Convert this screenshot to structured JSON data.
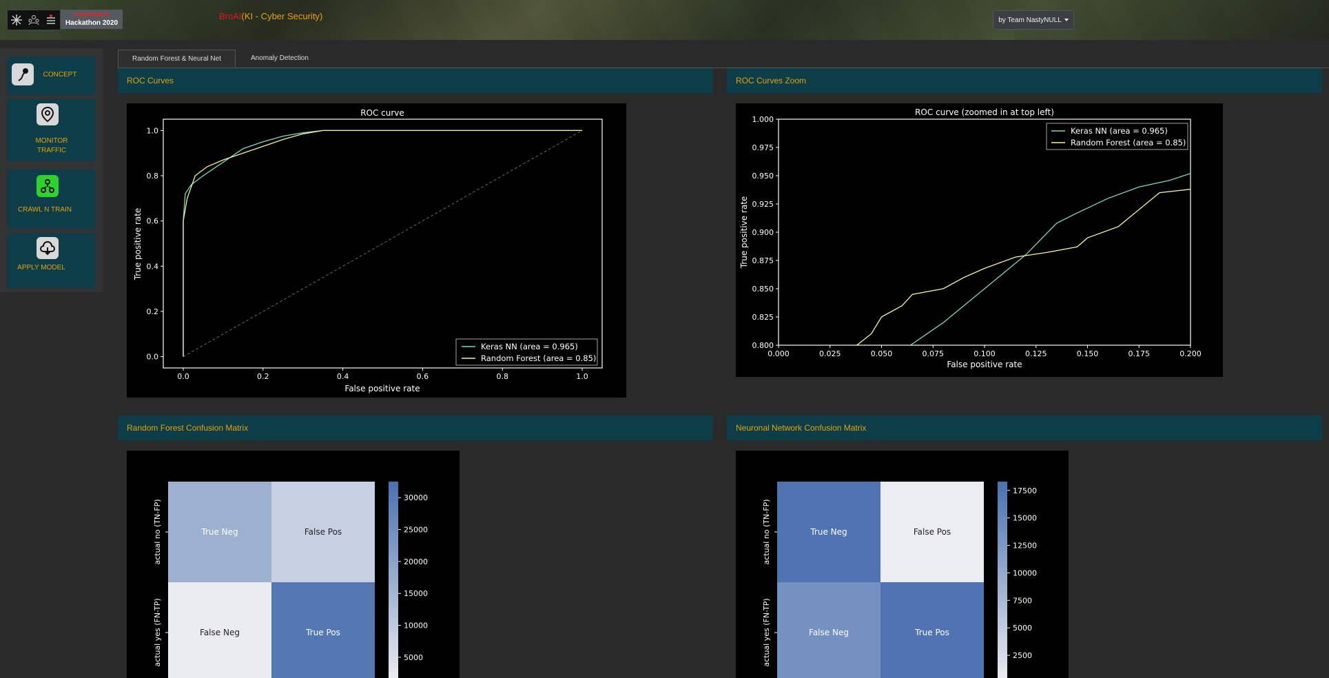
{
  "header": {
    "badge_small": "BUNDESWEHR",
    "badge_title": "Hackathon 2020",
    "brand_red": "BroAI",
    "brand_rest": "(KI - Cyber Security)",
    "team_button": "by Team NastyNULL",
    "logo_icons": [
      "cross-icon",
      "people-icon",
      "stack-icon"
    ]
  },
  "sidebar": {
    "items": [
      {
        "label": "CONCEPT",
        "icon": "sperm-icon"
      },
      {
        "label": "MONITOR TRAFFIC",
        "icon": "search-icon"
      },
      {
        "label": "CRAWL N TRAIN",
        "icon": "network-icon"
      },
      {
        "label": "APPLY MODEL",
        "icon": "cloud-icon"
      }
    ]
  },
  "tabs": [
    {
      "label": "Random Forest & Neural Net",
      "active": true
    },
    {
      "label": "Anomaly Detection",
      "active": false
    }
  ],
  "panels": {
    "roc": "ROC Curves",
    "roc_zoom": "ROC Curves Zoom",
    "rf_cm": "Random Forest Confusion Matrix",
    "nn_cm": "Neuronal Network Confusion Matrix"
  },
  "colors": {
    "accent": "#e6a300",
    "panel": "#0e3d4a",
    "nn_line": "#7fd8c4",
    "rf_line": "#f5f5a0"
  },
  "chart_data": [
    {
      "type": "line",
      "title": "ROC curve",
      "xlabel": "False positive rate",
      "ylabel": "True positive rate",
      "xlim": [
        -0.05,
        1.05
      ],
      "ylim": [
        -0.05,
        1.05
      ],
      "xticks": [
        "0.0",
        "0.2",
        "0.4",
        "0.6",
        "0.8",
        "1.0"
      ],
      "yticks": [
        "0.0",
        "0.2",
        "0.4",
        "0.6",
        "0.8",
        "1.0"
      ],
      "legend": "bottom-right",
      "series": [
        {
          "name": "Keras NN (area = 0.965)",
          "x": [
            0,
            0,
            0.005,
            0.02,
            0.05,
            0.1,
            0.15,
            0.2,
            0.25,
            0.3,
            0.35,
            0.5,
            0.8,
            1.0
          ],
          "y": [
            0,
            0.6,
            0.72,
            0.76,
            0.8,
            0.86,
            0.92,
            0.95,
            0.975,
            0.99,
            1.0,
            1.0,
            1.0,
            1.0
          ]
        },
        {
          "name": "Random Forest  (area = 0.85)",
          "x": [
            0,
            0,
            0.01,
            0.03,
            0.06,
            0.1,
            0.15,
            0.2,
            0.25,
            0.3,
            0.35,
            0.5,
            0.8,
            1.0
          ],
          "y": [
            0,
            0.6,
            0.7,
            0.8,
            0.84,
            0.87,
            0.9,
            0.93,
            0.96,
            0.985,
            1.0,
            1.0,
            1.0,
            1.0
          ]
        },
        {
          "name": "",
          "x": [
            0,
            1
          ],
          "y": [
            0,
            1
          ]
        }
      ]
    },
    {
      "type": "line",
      "title": "ROC curve (zoomed in at top left)",
      "xlabel": "False positive rate",
      "ylabel": "True positive rate",
      "xlim": [
        0,
        0.2
      ],
      "ylim": [
        0.8,
        1.0
      ],
      "xticks": [
        "0.000",
        "0.025",
        "0.050",
        "0.075",
        "0.100",
        "0.125",
        "0.150",
        "0.175",
        "0.200"
      ],
      "yticks": [
        "0.800",
        "0.825",
        "0.850",
        "0.875",
        "0.900",
        "0.925",
        "0.950",
        "0.975",
        "1.000"
      ],
      "legend": "top-right",
      "series": [
        {
          "name": "Keras NN (area = 0.965)",
          "x": [
            0.064,
            0.08,
            0.1,
            0.12,
            0.135,
            0.145,
            0.16,
            0.175,
            0.19,
            0.2
          ],
          "y": [
            0.8,
            0.82,
            0.85,
            0.88,
            0.908,
            0.917,
            0.93,
            0.94,
            0.946,
            0.952
          ]
        },
        {
          "name": "Random Forest  (area = 0.85)",
          "x": [
            0.038,
            0.045,
            0.05,
            0.06,
            0.065,
            0.08,
            0.09,
            0.1,
            0.115,
            0.13,
            0.145,
            0.15,
            0.165,
            0.175,
            0.185,
            0.2
          ],
          "y": [
            0.8,
            0.81,
            0.825,
            0.835,
            0.845,
            0.85,
            0.86,
            0.868,
            0.878,
            0.882,
            0.887,
            0.895,
            0.905,
            0.92,
            0.935,
            0.938
          ]
        }
      ]
    },
    {
      "type": "heatmap",
      "title": "",
      "ylabels": [
        "actual no (TN-FP)",
        "actual yes (FN-TP)"
      ],
      "cells": [
        [
          "True Neg",
          "False Pos"
        ],
        [
          "False Neg",
          "True Pos"
        ]
      ],
      "values": [
        [
          17000,
          9000
        ],
        [
          2000,
          31000
        ]
      ],
      "colorbar_ticks": [
        "5000",
        "10000",
        "15000",
        "20000",
        "25000",
        "30000"
      ],
      "colorbar_range": [
        1000,
        32500
      ]
    },
    {
      "type": "heatmap",
      "title": "",
      "ylabels": [
        "actual no (TN-FP)",
        "actual yes (FN-TP)"
      ],
      "cells": [
        [
          "True Neg",
          "False Pos"
        ],
        [
          "False Neg",
          "True Pos"
        ]
      ],
      "values": [
        [
          18000,
          500
        ],
        [
          14000,
          18000
        ]
      ],
      "colorbar_ticks": [
        "2500",
        "5000",
        "7500",
        "10000",
        "12500",
        "15000",
        "17500"
      ],
      "colorbar_range": [
        0,
        18300
      ]
    }
  ]
}
